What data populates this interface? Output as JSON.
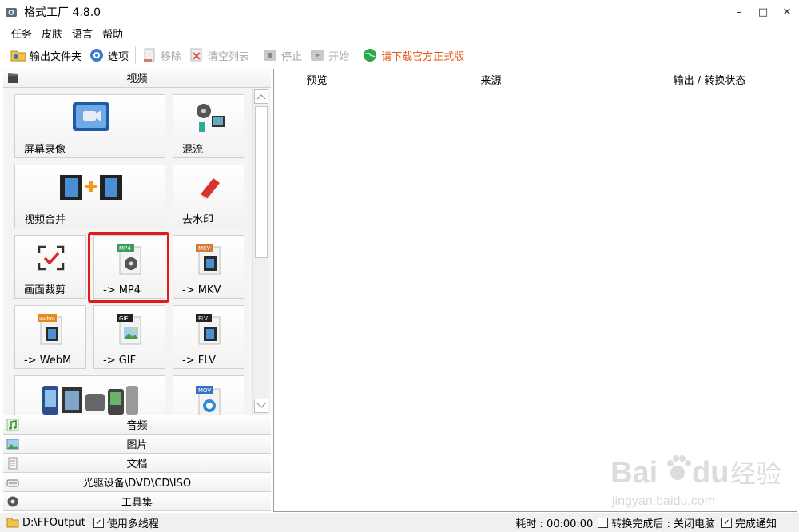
{
  "window": {
    "title": "格式工厂 4.8.0",
    "minimize": "–",
    "maximize": "□",
    "close": "✕"
  },
  "menu": [
    "任务",
    "皮肤",
    "语言",
    "帮助"
  ],
  "toolbar": {
    "output_folder": "输出文件夹",
    "options": "选项",
    "remove": "移除",
    "clear_list": "清空列表",
    "stop": "停止",
    "start": "开始",
    "download": "请下载官方正式版"
  },
  "left": {
    "video_header": "视频",
    "tiles": [
      {
        "label": "屏幕录像",
        "icon": "screen-record-icon"
      },
      {
        "label": "混流",
        "icon": "mux-icon"
      },
      {
        "label": "视频合并",
        "icon": "video-merge-icon"
      },
      {
        "label": "去水印",
        "icon": "remove-watermark-icon"
      },
      {
        "label": "画面裁剪",
        "icon": "crop-icon"
      },
      {
        "label": "-> MP4",
        "icon": "mp4-file-icon",
        "badge": "MP4"
      },
      {
        "label": "-> MKV",
        "icon": "mkv-file-icon",
        "badge": "MKV"
      },
      {
        "label": "-> WebM",
        "icon": "webm-file-icon",
        "badge": "webm"
      },
      {
        "label": "-> GIF",
        "icon": "gif-file-icon",
        "badge": "GIF"
      },
      {
        "label": "-> FLV",
        "icon": "flv-file-icon",
        "badge": "FLV"
      },
      {
        "label": "",
        "icon": "devices-icon"
      },
      {
        "label": "",
        "icon": "mov-file-icon",
        "badge": "MOV"
      }
    ],
    "categories": [
      "音频",
      "图片",
      "文档",
      "光驱设备\\DVD\\CD\\ISO",
      "工具集"
    ]
  },
  "list": {
    "col_preview": "预览",
    "col_source": "来源",
    "col_output": "输出 / 转换状态"
  },
  "status": {
    "output_path": "D:\\FFOutput",
    "multithread": "使用多线程",
    "multithread_checked": "✓",
    "elapsed": "耗时 : 00:00:00",
    "after_done": "转换完成后 : 关闭电脑",
    "notify": "完成通知",
    "notify_checked": "✓"
  },
  "watermark": {
    "brand": "Bai",
    "brand2": "du",
    "cn": "经验",
    "url": "jingyan.baidu.com"
  },
  "colors": {
    "accent_red": "#e11a1a",
    "download_orange": "#e8540e"
  }
}
